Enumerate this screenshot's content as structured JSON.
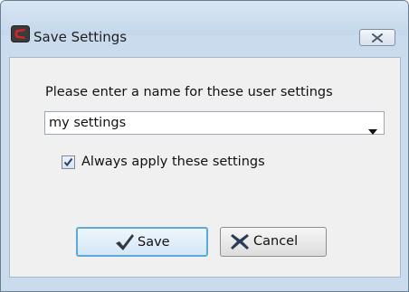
{
  "window": {
    "title": "Save Settings",
    "icon": "app-logo-icon",
    "close_icon": "close-x-icon"
  },
  "form": {
    "prompt": "Please enter a name for these user settings",
    "name_value": "my settings",
    "dropdown_icon": "chevron-down-icon",
    "always_apply_label": "Always apply these settings",
    "always_apply_checked": true
  },
  "buttons": {
    "save_label": "Save",
    "save_icon": "checkmark-icon",
    "cancel_label": "Cancel",
    "cancel_icon": "x-icon"
  },
  "colors": {
    "accent": "#5fa9d9",
    "title_bar": "#c9dbed",
    "logo_red": "#c8202a"
  }
}
